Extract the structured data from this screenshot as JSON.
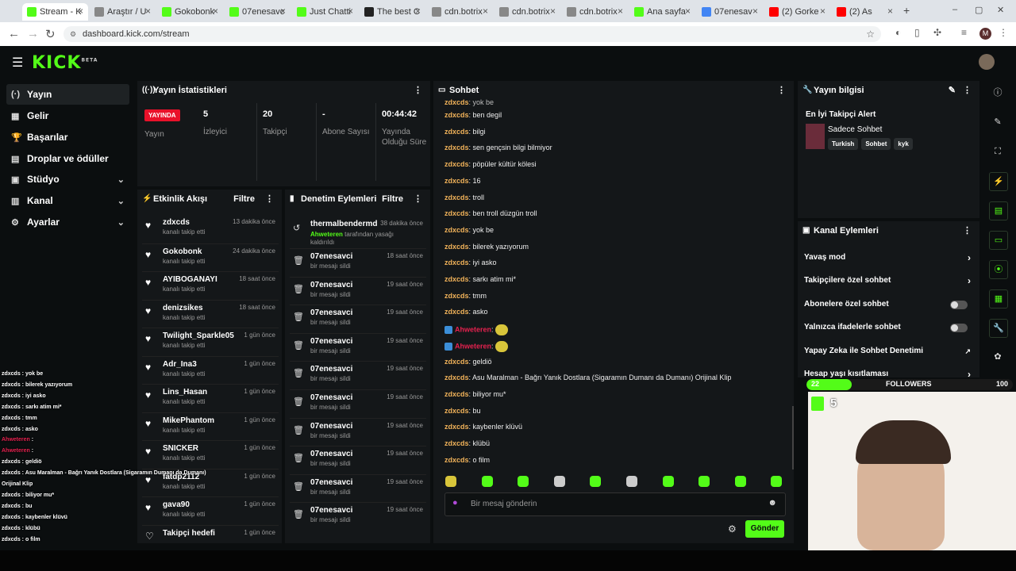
{
  "browser": {
    "tabs": [
      {
        "title": "Stream - K",
        "color": "#53fc18",
        "active": true
      },
      {
        "title": "Araştır / U",
        "color": "#888"
      },
      {
        "title": "Gokobonk",
        "color": "#53fc18"
      },
      {
        "title": "07enesavc",
        "color": "#53fc18"
      },
      {
        "title": "Just Chatti",
        "color": "#53fc18"
      },
      {
        "title": "The best C",
        "color": "#222"
      },
      {
        "title": "cdn.botrix",
        "color": "#888"
      },
      {
        "title": "cdn.botrix",
        "color": "#888"
      },
      {
        "title": "cdn.botrix",
        "color": "#888"
      },
      {
        "title": "Ana sayfa",
        "color": "#53fc18"
      },
      {
        "title": "07enesav",
        "color": "#4285f4"
      },
      {
        "title": "(2) Gorke",
        "color": "#ff0000"
      },
      {
        "title": "(2) As",
        "color": "#ff0000"
      }
    ],
    "url": "dashboard.kick.com/stream",
    "profile_initial": "M"
  },
  "kick": {
    "logo": "KICK",
    "beta": "BETA"
  },
  "sidebar": {
    "items": [
      {
        "label": "Yayın",
        "icon": "(·)"
      },
      {
        "label": "Gelir",
        "icon": "▦"
      },
      {
        "label": "Başarılar",
        "icon": "🏆"
      },
      {
        "label": "Droplar ve ödüller",
        "icon": "▤"
      },
      {
        "label": "Stüdyo",
        "icon": "▣"
      },
      {
        "label": "Kanal",
        "icon": "▥"
      },
      {
        "label": "Ayarlar",
        "icon": "⚙"
      }
    ]
  },
  "stats": {
    "title": "Yayın İstatistikleri",
    "live_badge": "YAYINDA",
    "live_label": "Yayın",
    "items": [
      {
        "value": "5",
        "label": "İzleyici"
      },
      {
        "value": "20",
        "label": "Takipçi"
      },
      {
        "value": "-",
        "label": "Abone Sayısı"
      },
      {
        "value": "00:44:42",
        "label": "Yayında Olduğu Süre"
      }
    ]
  },
  "activity": {
    "title": "Etkinlik Akışı",
    "filter": "Filtre",
    "rows": [
      {
        "name": "zdxcds",
        "sub": "kanalı takip etti",
        "time": "13 dakika önce"
      },
      {
        "name": "Gokobonk",
        "sub": "kanalı takip etti",
        "time": "24 dakika önce"
      },
      {
        "name": "AYIBOGANAYI",
        "sub": "kanalı takip etti",
        "time": "18 saat önce"
      },
      {
        "name": "denizsikes",
        "sub": "kanalı takip etti",
        "time": "18 saat önce"
      },
      {
        "name": "Twilight_Sparkle05",
        "sub": "kanalı takip etti",
        "time": "1 gün önce"
      },
      {
        "name": "Adr_Ina3",
        "sub": "kanalı takip etti",
        "time": "1 gün önce"
      },
      {
        "name": "Lins_Hasan",
        "sub": "kanalı takip etti",
        "time": "1 gün önce"
      },
      {
        "name": "MikePhantom",
        "sub": "kanalı takip etti",
        "time": "1 gün önce"
      },
      {
        "name": "SNICKER",
        "sub": "kanalı takip etti",
        "time": "1 gün önce"
      },
      {
        "name": "fatdp2112",
        "sub": "kanalı takip etti",
        "time": "1 gün önce"
      },
      {
        "name": "gava90",
        "sub": "kanalı takip etti",
        "time": "1 gün önce"
      },
      {
        "name": "Takipçi hedefi",
        "sub": "",
        "time": "1 gün önce"
      }
    ]
  },
  "moderation": {
    "title": "Denetim Eylemleri",
    "filter": "Filtre",
    "first": {
      "name": "thermalbendermd",
      "time": "38 dakika önce",
      "actor": "Ahweteren",
      "rest": "tarafından yasağı",
      "rest2": "kaldırıldı"
    },
    "rows": [
      {
        "name": "07enesavci",
        "sub": "bir mesajı sildi",
        "time": "18 saat önce"
      },
      {
        "name": "07enesavci",
        "sub": "bir mesajı sildi",
        "time": "19 saat önce"
      },
      {
        "name": "07enesavci",
        "sub": "bir mesajı sildi",
        "time": "19 saat önce"
      },
      {
        "name": "07enesavci",
        "sub": "bir mesajı sildi",
        "time": "19 saat önce"
      },
      {
        "name": "07enesavci",
        "sub": "bir mesajı sildi",
        "time": "19 saat önce"
      },
      {
        "name": "07enesavci",
        "sub": "bir mesajı sildi",
        "time": "19 saat önce"
      },
      {
        "name": "07enesavci",
        "sub": "bir mesajı sildi",
        "time": "19 saat önce"
      },
      {
        "name": "07enesavci",
        "sub": "bir mesajı sildi",
        "time": "19 saat önce"
      },
      {
        "name": "07enesavci",
        "sub": "bir mesajı sildi",
        "time": "19 saat önce"
      },
      {
        "name": "07enesavci",
        "sub": "bir mesajı sildi",
        "time": "19 saat önce"
      }
    ]
  },
  "chat": {
    "title": "Sohbet",
    "messages": [
      {
        "user": "zdxcds",
        "text": "ben degil"
      },
      {
        "user": "zdxcds",
        "text": "bilgi"
      },
      {
        "user": "zdxcds",
        "text": "sen gençsin bilgi bilmiyor"
      },
      {
        "user": "zdxcds",
        "text": "pöpüler kültür kölesi"
      },
      {
        "user": "zdxcds",
        "text": "16"
      },
      {
        "user": "zdxcds",
        "text": "troll"
      },
      {
        "user": "zdxcds",
        "text": "ben troll düzgün troll"
      },
      {
        "user": "zdxcds",
        "text": "yok be"
      },
      {
        "user": "zdxcds",
        "text": "bilerek yazıyorum"
      },
      {
        "user": "zdxcds",
        "text": "iyi asko"
      },
      {
        "user": "zdxcds",
        "text": "sarkı atim mi*"
      },
      {
        "user": "zdxcds",
        "text": "tmm"
      },
      {
        "user": "zdxcds",
        "text": "asko"
      },
      {
        "user": "Ahweteren",
        "text": ""
      },
      {
        "user": "Ahweteren",
        "text": ""
      },
      {
        "user": "zdxcds",
        "text": "geldiö"
      },
      {
        "user": "zdxcds",
        "text": "Asu Maralman - Bağrı Yanık Dostlara (Sigaramın Dumanı da Dumanı) Orijinal Klip"
      },
      {
        "user": "zdxcds",
        "text": "biliyor mu*"
      },
      {
        "user": "zdxcds",
        "text": "bu"
      },
      {
        "user": "zdxcds",
        "text": "kaybenler klüvü"
      },
      {
        "user": "zdxcds",
        "text": "klübü"
      },
      {
        "user": "zdxcds",
        "text": "o film"
      }
    ],
    "top_partial": "yok be",
    "input_placeholder": "Bir mesaj gönderin",
    "send_label": "Gönder"
  },
  "streaminfo": {
    "title": "Yayın bilgisi",
    "stream_title": "En İyi Takipçi Alert",
    "category": "Sadece Sohbet",
    "tags": [
      "Turkish",
      "Sohbet",
      "kyk"
    ]
  },
  "channel_actions": {
    "title": "Kanal Eylemleri",
    "items": [
      {
        "label": "Yavaş mod",
        "kind": "chevron"
      },
      {
        "label": "Takipçilere özel sohbet",
        "kind": "chevron"
      },
      {
        "label": "Abonelere özel sohbet",
        "kind": "toggle"
      },
      {
        "label": "Yalnızca ifadelerle sohbet",
        "kind": "toggle"
      },
      {
        "label": "Yapay Zeka ile Sohbet Denetimi",
        "kind": "external"
      },
      {
        "label": "Hesap yaşı kısıtlaması",
        "kind": "chevron"
      }
    ]
  },
  "overlay": {
    "followers_label": "FOLLOWERS",
    "followers_current": "22",
    "followers_goal": "100",
    "followers_progress": 0.22,
    "viewer_count": "5"
  },
  "ghost_chat": [
    {
      "user": "zdxcds",
      "text": "yok be"
    },
    {
      "user": "zdxcds",
      "text": "bilerek yazıyorum"
    },
    {
      "user": "zdxcds",
      "text": "iyi asko"
    },
    {
      "user": "zdxcds",
      "text": "sarkı atim mi*"
    },
    {
      "user": "zdxcds",
      "text": "tmm"
    },
    {
      "user": "zdxcds",
      "text": "asko"
    },
    {
      "user": "Ahweteren",
      "text": ""
    },
    {
      "user": "Ahweteren",
      "text": ""
    },
    {
      "user": "zdxcds",
      "text": "geldiö"
    },
    {
      "user": "zdxcds",
      "text": "Asu Maralman - Bağrı Yanık Dostlara (Sigaramın Dumanı da Dumanı)"
    },
    {
      "user": "",
      "text": "Orijinal Klip"
    },
    {
      "user": "zdxcds",
      "text": "biliyor mu*"
    },
    {
      "user": "zdxcds",
      "text": "bu"
    },
    {
      "user": "zdxcds",
      "text": "kaybenler klüvü"
    },
    {
      "user": "zdxcds",
      "text": "klübü"
    },
    {
      "user": "zdxcds",
      "text": "o film"
    }
  ]
}
